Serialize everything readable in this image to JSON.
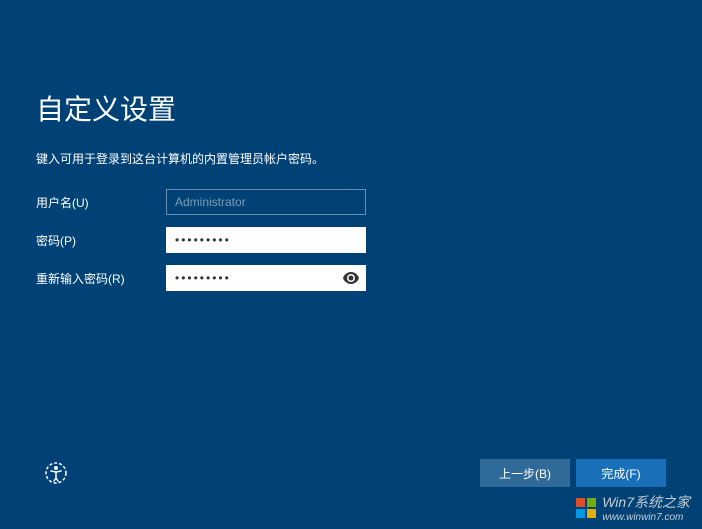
{
  "title": "自定义设置",
  "subtitle": "键入可用于登录到这台计算机的内置管理员帐户密码。",
  "form": {
    "username_label": "用户名(U)",
    "username_value": "Administrator",
    "password_label": "密码(P)",
    "password_value": "•••••••••",
    "reenter_label": "重新输入密码(R)",
    "reenter_value": "•••••••••"
  },
  "buttons": {
    "back": "上一步(B)",
    "finish": "完成(F)"
  },
  "watermark": {
    "text": "Win7系统之家",
    "url": "www.winwin7.com"
  }
}
